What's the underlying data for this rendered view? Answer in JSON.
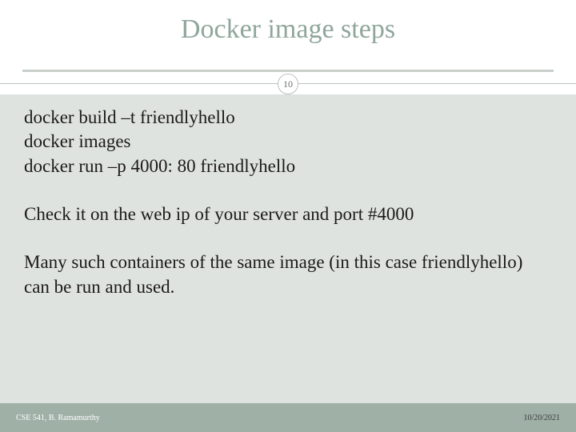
{
  "slide": {
    "title": "Docker image steps",
    "page_number": "10",
    "body": {
      "commands": [
        "docker build –t friendlyhello",
        "docker images",
        "docker run –p 4000: 80 friendlyhello"
      ],
      "para1": "Check it on the web ip of your server and port #4000",
      "para2": "Many such containers of the same image (in this case friendlyhello) can be run and used."
    },
    "footer": {
      "left": "CSE 541, B. Ramamurthy",
      "right": "10/20/2021"
    }
  }
}
